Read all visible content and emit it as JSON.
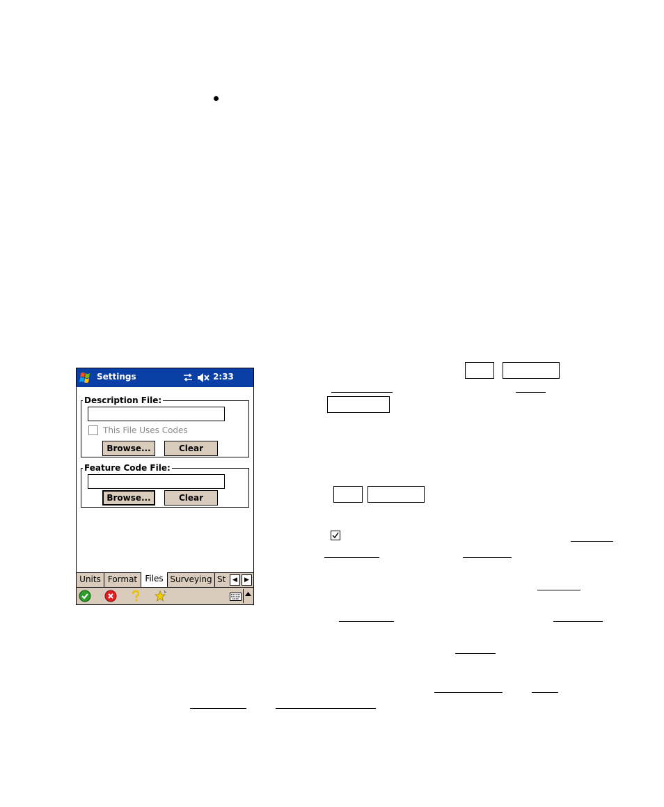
{
  "device": {
    "title": "Settings",
    "clock": "2:33",
    "description_group": {
      "legend": "Description File:",
      "input_value": "",
      "checkbox_label": "This File Uses Codes",
      "browse_label": "Browse...",
      "clear_label": "Clear"
    },
    "feature_group": {
      "legend": "Feature Code File:",
      "input_value": "",
      "browse_label": "Browse...",
      "clear_label": "Clear"
    },
    "tabs": [
      {
        "label": "Units"
      },
      {
        "label": "Format"
      },
      {
        "label": "Files"
      },
      {
        "label": "Surveying"
      },
      {
        "label": "St"
      }
    ],
    "menu_icons": [
      "ok-icon",
      "cancel-icon",
      "help-icon",
      "favorites-icon",
      "keyboard-icon"
    ]
  },
  "colors": {
    "titlebar": "#0a3fa6",
    "chrome": "#d9ccbd",
    "ok": "#2a9d2a",
    "cancel": "#e02020",
    "help": "#e8c000"
  }
}
